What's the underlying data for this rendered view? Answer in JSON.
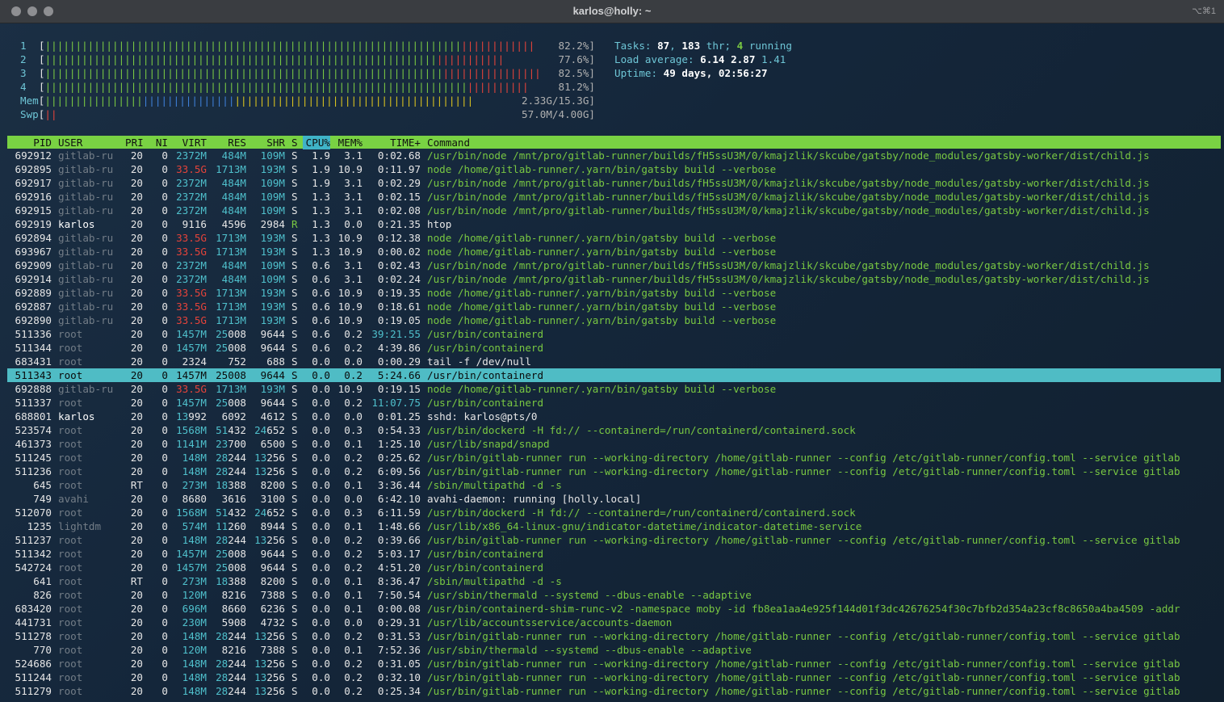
{
  "window": {
    "title": "karlos@holly: ~",
    "shortcut": "⌥⌘1"
  },
  "meters": [
    {
      "label": "1",
      "value": "82.2%]",
      "bars": [
        {
          "c": "g",
          "n": 68
        },
        {
          "c": "r",
          "n": 12
        }
      ]
    },
    {
      "label": "2",
      "value": "77.6%]",
      "bars": [
        {
          "c": "g",
          "n": 64
        },
        {
          "c": "r",
          "n": 11
        }
      ]
    },
    {
      "label": "3",
      "value": "82.5%]",
      "bars": [
        {
          "c": "g",
          "n": 65
        },
        {
          "c": "r",
          "n": 16
        }
      ]
    },
    {
      "label": "4",
      "value": "81.2%]",
      "bars": [
        {
          "c": "g",
          "n": 69
        },
        {
          "c": "r",
          "n": 10
        }
      ]
    },
    {
      "label": "Mem",
      "value": "2.33G/15.3G]",
      "bars": [
        {
          "c": "g",
          "n": 16
        },
        {
          "c": "b",
          "n": 15
        },
        {
          "c": "y",
          "n": 39
        }
      ]
    },
    {
      "label": "Swp",
      "value": "57.0M/4.00G]",
      "bars": [
        {
          "c": "r",
          "n": 2
        }
      ]
    }
  ],
  "info": {
    "tasks_label": "Tasks: ",
    "tasks": "87",
    "thr_sep": ", ",
    "thr": "183",
    "thr_label": " thr; ",
    "running": "4",
    "running_label": " running",
    "load_label": "Load average: ",
    "load1": "6.14",
    "load5": "2.87",
    "load15": "1.41",
    "uptime_label": "Uptime: ",
    "uptime": "49 days, 02:56:27"
  },
  "header": {
    "pid": "PID",
    "user": "USER",
    "pri": "PRI",
    "ni": "NI",
    "virt": "VIRT",
    "res": "RES",
    "shr": "SHR",
    "s": "S",
    "cpu": "CPU%",
    "mem": "MEM%",
    "time": "TIME+",
    "cmd": "Command"
  },
  "processes": [
    {
      "pid": "692912",
      "user": "gitlab-ru",
      "pri": "20",
      "ni": "0",
      "virt": "2372M",
      "res": "484M",
      "shr": "109M",
      "s": "S",
      "cpu": "1.9",
      "mem": "3.1",
      "time": "0:02.68",
      "cmd": "/usr/bin/node /mnt/pro/gitlab-runner/builds/fH5ssU3M/0/kmajzlik/skcube/gatsby/node_modules/gatsby-worker/dist/child.js"
    },
    {
      "pid": "692895",
      "user": "gitlab-ru",
      "pri": "20",
      "ni": "0",
      "virt": "33.5G",
      "res": "1713M",
      "shr": "193M",
      "s": "S",
      "cpu": "1.9",
      "mem": "10.9",
      "time": "0:11.97",
      "cmd": "node /home/gitlab-runner/.yarn/bin/gatsby build --verbose"
    },
    {
      "pid": "692917",
      "user": "gitlab-ru",
      "pri": "20",
      "ni": "0",
      "virt": "2372M",
      "res": "484M",
      "shr": "109M",
      "s": "S",
      "cpu": "1.9",
      "mem": "3.1",
      "time": "0:02.29",
      "cmd": "/usr/bin/node /mnt/pro/gitlab-runner/builds/fH5ssU3M/0/kmajzlik/skcube/gatsby/node_modules/gatsby-worker/dist/child.js"
    },
    {
      "pid": "692916",
      "user": "gitlab-ru",
      "pri": "20",
      "ni": "0",
      "virt": "2372M",
      "res": "484M",
      "shr": "109M",
      "s": "S",
      "cpu": "1.3",
      "mem": "3.1",
      "time": "0:02.15",
      "cmd": "/usr/bin/node /mnt/pro/gitlab-runner/builds/fH5ssU3M/0/kmajzlik/skcube/gatsby/node_modules/gatsby-worker/dist/child.js"
    },
    {
      "pid": "692915",
      "user": "gitlab-ru",
      "pri": "20",
      "ni": "0",
      "virt": "2372M",
      "res": "484M",
      "shr": "109M",
      "s": "S",
      "cpu": "1.3",
      "mem": "3.1",
      "time": "0:02.08",
      "cmd": "/usr/bin/node /mnt/pro/gitlab-runner/builds/fH5ssU3M/0/kmajzlik/skcube/gatsby/node_modules/gatsby-worker/dist/child.js"
    },
    {
      "pid": "692919",
      "user": "karlos",
      "pri": "20",
      "ni": "0",
      "virt": "9116",
      "res": "4596",
      "shr": "2984",
      "s": "R",
      "cpu": "1.3",
      "mem": "0.0",
      "time": "0:21.35",
      "cmd": "htop"
    },
    {
      "pid": "692894",
      "user": "gitlab-ru",
      "pri": "20",
      "ni": "0",
      "virt": "33.5G",
      "res": "1713M",
      "shr": "193M",
      "s": "S",
      "cpu": "1.3",
      "mem": "10.9",
      "time": "0:12.38",
      "cmd": "node /home/gitlab-runner/.yarn/bin/gatsby build --verbose"
    },
    {
      "pid": "693967",
      "user": "gitlab-ru",
      "pri": "20",
      "ni": "0",
      "virt": "33.5G",
      "res": "1713M",
      "shr": "193M",
      "s": "S",
      "cpu": "1.3",
      "mem": "10.9",
      "time": "0:00.02",
      "cmd": "node /home/gitlab-runner/.yarn/bin/gatsby build --verbose"
    },
    {
      "pid": "692909",
      "user": "gitlab-ru",
      "pri": "20",
      "ni": "0",
      "virt": "2372M",
      "res": "484M",
      "shr": "109M",
      "s": "S",
      "cpu": "0.6",
      "mem": "3.1",
      "time": "0:02.43",
      "cmd": "/usr/bin/node /mnt/pro/gitlab-runner/builds/fH5ssU3M/0/kmajzlik/skcube/gatsby/node_modules/gatsby-worker/dist/child.js"
    },
    {
      "pid": "692914",
      "user": "gitlab-ru",
      "pri": "20",
      "ni": "0",
      "virt": "2372M",
      "res": "484M",
      "shr": "109M",
      "s": "S",
      "cpu": "0.6",
      "mem": "3.1",
      "time": "0:02.24",
      "cmd": "/usr/bin/node /mnt/pro/gitlab-runner/builds/fH5ssU3M/0/kmajzlik/skcube/gatsby/node_modules/gatsby-worker/dist/child.js"
    },
    {
      "pid": "692889",
      "user": "gitlab-ru",
      "pri": "20",
      "ni": "0",
      "virt": "33.5G",
      "res": "1713M",
      "shr": "193M",
      "s": "S",
      "cpu": "0.6",
      "mem": "10.9",
      "time": "0:19.35",
      "cmd": "node /home/gitlab-runner/.yarn/bin/gatsby build --verbose"
    },
    {
      "pid": "692887",
      "user": "gitlab-ru",
      "pri": "20",
      "ni": "0",
      "virt": "33.5G",
      "res": "1713M",
      "shr": "193M",
      "s": "S",
      "cpu": "0.6",
      "mem": "10.9",
      "time": "0:18.61",
      "cmd": "node /home/gitlab-runner/.yarn/bin/gatsby build --verbose"
    },
    {
      "pid": "692890",
      "user": "gitlab-ru",
      "pri": "20",
      "ni": "0",
      "virt": "33.5G",
      "res": "1713M",
      "shr": "193M",
      "s": "S",
      "cpu": "0.6",
      "mem": "10.9",
      "time": "0:19.05",
      "cmd": "node /home/gitlab-runner/.yarn/bin/gatsby build --verbose"
    },
    {
      "pid": "511336",
      "user": "root",
      "pri": "20",
      "ni": "0",
      "virt": "1457M",
      "res": "25008",
      "shr": "9644",
      "s": "S",
      "cpu": "0.6",
      "mem": "0.2",
      "time": "39:21.55",
      "cmd": "/usr/bin/containerd"
    },
    {
      "pid": "511344",
      "user": "root",
      "pri": "20",
      "ni": "0",
      "virt": "1457M",
      "res": "25008",
      "shr": "9644",
      "s": "S",
      "cpu": "0.6",
      "mem": "0.2",
      "time": "4:39.86",
      "cmd": "/usr/bin/containerd"
    },
    {
      "pid": "683431",
      "user": "root",
      "pri": "20",
      "ni": "0",
      "virt": "2324",
      "res": "752",
      "shr": "688",
      "s": "S",
      "cpu": "0.0",
      "mem": "0.0",
      "time": "0:00.29",
      "cmd": "tail -f /dev/null"
    },
    {
      "pid": "511343",
      "user": "root",
      "pri": "20",
      "ni": "0",
      "virt": "1457M",
      "res": "25008",
      "shr": "9644",
      "s": "S",
      "cpu": "0.0",
      "mem": "0.2",
      "time": "5:24.66",
      "cmd": "/usr/bin/containerd",
      "selected": true
    },
    {
      "pid": "692888",
      "user": "gitlab-ru",
      "pri": "20",
      "ni": "0",
      "virt": "33.5G",
      "res": "1713M",
      "shr": "193M",
      "s": "S",
      "cpu": "0.0",
      "mem": "10.9",
      "time": "0:19.15",
      "cmd": "node /home/gitlab-runner/.yarn/bin/gatsby build --verbose"
    },
    {
      "pid": "511337",
      "user": "root",
      "pri": "20",
      "ni": "0",
      "virt": "1457M",
      "res": "25008",
      "shr": "9644",
      "s": "S",
      "cpu": "0.0",
      "mem": "0.2",
      "time": "11:07.75",
      "cmd": "/usr/bin/containerd"
    },
    {
      "pid": "688801",
      "user": "karlos",
      "pri": "20",
      "ni": "0",
      "virt": "13992",
      "res": "6092",
      "shr": "4612",
      "s": "S",
      "cpu": "0.0",
      "mem": "0.0",
      "time": "0:01.25",
      "cmd": "sshd: karlos@pts/0"
    },
    {
      "pid": "523574",
      "user": "root",
      "pri": "20",
      "ni": "0",
      "virt": "1568M",
      "res": "51432",
      "shr": "24652",
      "s": "S",
      "cpu": "0.0",
      "mem": "0.3",
      "time": "0:54.33",
      "cmd": "/usr/bin/dockerd -H fd:// --containerd=/run/containerd/containerd.sock"
    },
    {
      "pid": "461373",
      "user": "root",
      "pri": "20",
      "ni": "0",
      "virt": "1141M",
      "res": "23700",
      "shr": "6500",
      "s": "S",
      "cpu": "0.0",
      "mem": "0.1",
      "time": "1:25.10",
      "cmd": "/usr/lib/snapd/snapd"
    },
    {
      "pid": "511245",
      "user": "root",
      "pri": "20",
      "ni": "0",
      "virt": "148M",
      "res": "28244",
      "shr": "13256",
      "s": "S",
      "cpu": "0.0",
      "mem": "0.2",
      "time": "0:25.62",
      "cmd": "/usr/bin/gitlab-runner run --working-directory /home/gitlab-runner --config /etc/gitlab-runner/config.toml --service gitlab"
    },
    {
      "pid": "511236",
      "user": "root",
      "pri": "20",
      "ni": "0",
      "virt": "148M",
      "res": "28244",
      "shr": "13256",
      "s": "S",
      "cpu": "0.0",
      "mem": "0.2",
      "time": "6:09.56",
      "cmd": "/usr/bin/gitlab-runner run --working-directory /home/gitlab-runner --config /etc/gitlab-runner/config.toml --service gitlab"
    },
    {
      "pid": "645",
      "user": "root",
      "pri": "RT",
      "ni": "0",
      "virt": "273M",
      "res": "18388",
      "shr": "8200",
      "s": "S",
      "cpu": "0.0",
      "mem": "0.1",
      "time": "3:36.44",
      "cmd": "/sbin/multipathd -d -s"
    },
    {
      "pid": "749",
      "user": "avahi",
      "pri": "20",
      "ni": "0",
      "virt": "8680",
      "res": "3616",
      "shr": "3100",
      "s": "S",
      "cpu": "0.0",
      "mem": "0.0",
      "time": "6:42.10",
      "cmd": "avahi-daemon: running [holly.local]"
    },
    {
      "pid": "512070",
      "user": "root",
      "pri": "20",
      "ni": "0",
      "virt": "1568M",
      "res": "51432",
      "shr": "24652",
      "s": "S",
      "cpu": "0.0",
      "mem": "0.3",
      "time": "6:11.59",
      "cmd": "/usr/bin/dockerd -H fd:// --containerd=/run/containerd/containerd.sock"
    },
    {
      "pid": "1235",
      "user": "lightdm",
      "pri": "20",
      "ni": "0",
      "virt": "574M",
      "res": "11260",
      "shr": "8944",
      "s": "S",
      "cpu": "0.0",
      "mem": "0.1",
      "time": "1:48.66",
      "cmd": "/usr/lib/x86_64-linux-gnu/indicator-datetime/indicator-datetime-service"
    },
    {
      "pid": "511237",
      "user": "root",
      "pri": "20",
      "ni": "0",
      "virt": "148M",
      "res": "28244",
      "shr": "13256",
      "s": "S",
      "cpu": "0.0",
      "mem": "0.2",
      "time": "0:39.66",
      "cmd": "/usr/bin/gitlab-runner run --working-directory /home/gitlab-runner --config /etc/gitlab-runner/config.toml --service gitlab"
    },
    {
      "pid": "511342",
      "user": "root",
      "pri": "20",
      "ni": "0",
      "virt": "1457M",
      "res": "25008",
      "shr": "9644",
      "s": "S",
      "cpu": "0.0",
      "mem": "0.2",
      "time": "5:03.17",
      "cmd": "/usr/bin/containerd"
    },
    {
      "pid": "542724",
      "user": "root",
      "pri": "20",
      "ni": "0",
      "virt": "1457M",
      "res": "25008",
      "shr": "9644",
      "s": "S",
      "cpu": "0.0",
      "mem": "0.2",
      "time": "4:51.20",
      "cmd": "/usr/bin/containerd"
    },
    {
      "pid": "641",
      "user": "root",
      "pri": "RT",
      "ni": "0",
      "virt": "273M",
      "res": "18388",
      "shr": "8200",
      "s": "S",
      "cpu": "0.0",
      "mem": "0.1",
      "time": "8:36.47",
      "cmd": "/sbin/multipathd -d -s"
    },
    {
      "pid": "826",
      "user": "root",
      "pri": "20",
      "ni": "0",
      "virt": "120M",
      "res": "8216",
      "shr": "7388",
      "s": "S",
      "cpu": "0.0",
      "mem": "0.1",
      "time": "7:50.54",
      "cmd": "/usr/sbin/thermald --systemd --dbus-enable --adaptive"
    },
    {
      "pid": "683420",
      "user": "root",
      "pri": "20",
      "ni": "0",
      "virt": "696M",
      "res": "8660",
      "shr": "6236",
      "s": "S",
      "cpu": "0.0",
      "mem": "0.1",
      "time": "0:00.08",
      "cmd": "/usr/bin/containerd-shim-runc-v2 -namespace moby -id fb8ea1aa4e925f144d01f3dc42676254f30c7bfb2d354a23cf8c8650a4ba4509 -addr"
    },
    {
      "pid": "441731",
      "user": "root",
      "pri": "20",
      "ni": "0",
      "virt": "230M",
      "res": "5908",
      "shr": "4732",
      "s": "S",
      "cpu": "0.0",
      "mem": "0.0",
      "time": "0:29.31",
      "cmd": "/usr/lib/accountsservice/accounts-daemon"
    },
    {
      "pid": "511278",
      "user": "root",
      "pri": "20",
      "ni": "0",
      "virt": "148M",
      "res": "28244",
      "shr": "13256",
      "s": "S",
      "cpu": "0.0",
      "mem": "0.2",
      "time": "0:31.53",
      "cmd": "/usr/bin/gitlab-runner run --working-directory /home/gitlab-runner --config /etc/gitlab-runner/config.toml --service gitlab"
    },
    {
      "pid": "770",
      "user": "root",
      "pri": "20",
      "ni": "0",
      "virt": "120M",
      "res": "8216",
      "shr": "7388",
      "s": "S",
      "cpu": "0.0",
      "mem": "0.1",
      "time": "7:52.36",
      "cmd": "/usr/sbin/thermald --systemd --dbus-enable --adaptive"
    },
    {
      "pid": "524686",
      "user": "root",
      "pri": "20",
      "ni": "0",
      "virt": "148M",
      "res": "28244",
      "shr": "13256",
      "s": "S",
      "cpu": "0.0",
      "mem": "0.2",
      "time": "0:31.05",
      "cmd": "/usr/bin/gitlab-runner run --working-directory /home/gitlab-runner --config /etc/gitlab-runner/config.toml --service gitlab"
    },
    {
      "pid": "511244",
      "user": "root",
      "pri": "20",
      "ni": "0",
      "virt": "148M",
      "res": "28244",
      "shr": "13256",
      "s": "S",
      "cpu": "0.0",
      "mem": "0.2",
      "time": "0:32.10",
      "cmd": "/usr/bin/gitlab-runner run --working-directory /home/gitlab-runner --config /etc/gitlab-runner/config.toml --service gitlab"
    },
    {
      "pid": "511279",
      "user": "root",
      "pri": "20",
      "ni": "0",
      "virt": "148M",
      "res": "28244",
      "shr": "13256",
      "s": "S",
      "cpu": "0.0",
      "mem": "0.2",
      "time": "0:25.34",
      "cmd": "/usr/bin/gitlab-runner run --working-directory /home/gitlab-runner --config /etc/gitlab-runner/config.toml --service gitlab"
    }
  ]
}
